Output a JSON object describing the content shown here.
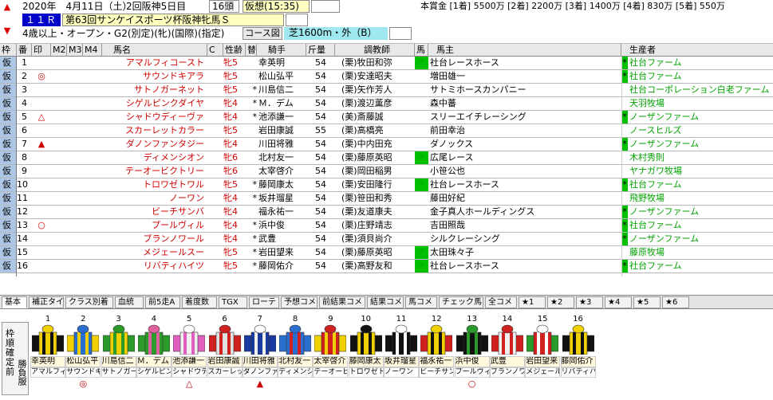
{
  "header": {
    "date": "2020年　4月11日（土）",
    "meeting": "2回阪神5日目",
    "heads": "16頭",
    "forecast": "仮想(15:35)",
    "race_no": "１１Ｒ",
    "race_name": "第63回サンケイスポーツ杯阪神牝馬Ｓ",
    "conditions": "4歳以上・オープン・G2(別定)(牝)(国際)(指定)",
    "course_label": "コース図",
    "course": "芝1600m・外（B）",
    "prize": "本賞金 [1着] 5500万 [2着] 2200万 [3着] 1400万 [4着] 830万 [5着] 550万",
    "up_arrow": "▲",
    "down_arrow": "▼"
  },
  "columns": [
    "枠",
    "番",
    "印",
    "M2",
    "M3",
    "M4",
    "馬名",
    "C",
    "性齢",
    "替",
    "騎手",
    "斤量",
    "調教師",
    "馬",
    "馬主",
    "生産者"
  ],
  "rows": [
    {
      "waku": "仮",
      "num": "1",
      "mark": "",
      "name": "アマルフィコースト",
      "sex": "牝5",
      "change": "",
      "jockey": "幸英明",
      "weight": "54",
      "trainer": "(栗)牧田和弥",
      "flag": "*",
      "owner": "社台レースホース",
      "bflag": "*",
      "breeder": "社台ファーム"
    },
    {
      "waku": "仮",
      "num": "2",
      "mark": "◎",
      "name": "サウンドキアラ",
      "sex": "牝5",
      "change": "",
      "jockey": "松山弘平",
      "weight": "54",
      "trainer": "(栗)安達昭夫",
      "flag": "",
      "owner": "増田雄一",
      "bflag": "*",
      "breeder": "社台ファーム"
    },
    {
      "waku": "仮",
      "num": "3",
      "mark": "",
      "name": "サトノガーネット",
      "sex": "牝5",
      "change": "*",
      "jockey": "川島信二",
      "weight": "54",
      "trainer": "(栗)矢作芳人",
      "flag": "",
      "owner": "サトミホースカンパニー",
      "bflag": "",
      "breeder": "社台コーポレーション白老ファーム"
    },
    {
      "waku": "仮",
      "num": "4",
      "mark": "",
      "name": "シゲルピンクダイヤ",
      "sex": "牝4",
      "change": "*",
      "jockey": "Ｍ．デム",
      "weight": "54",
      "trainer": "(栗)渡辺薫彦",
      "flag": "",
      "owner": "森中蕃",
      "bflag": "",
      "breeder": "天羽牧場"
    },
    {
      "waku": "仮",
      "num": "5",
      "mark": "△",
      "name": "シャドウディーヴァ",
      "sex": "牝4",
      "change": "*",
      "jockey": "池添謙一",
      "weight": "54",
      "trainer": "(美)斎藤誠",
      "flag": "",
      "owner": "スリーエイチレーシング",
      "bflag": "*",
      "breeder": "ノーザンファーム"
    },
    {
      "waku": "仮",
      "num": "6",
      "mark": "",
      "name": "スカーレットカラー",
      "sex": "牝5",
      "change": "",
      "jockey": "岩田康誠",
      "weight": "55",
      "trainer": "(栗)高橋亮",
      "flag": "",
      "owner": "前田幸治",
      "bflag": "",
      "breeder": "ノースヒルズ"
    },
    {
      "waku": "仮",
      "num": "7",
      "mark": "▲",
      "name": "ダノンファンタジー",
      "sex": "牝4",
      "change": "",
      "jockey": "川田将雅",
      "weight": "54",
      "trainer": "(栗)中内田充",
      "flag": "",
      "owner": "ダノックス",
      "bflag": "*",
      "breeder": "ノーザンファーム"
    },
    {
      "waku": "仮",
      "num": "8",
      "mark": "",
      "name": "ディメンシオン",
      "sex": "牝6",
      "change": "",
      "jockey": "北村友一",
      "weight": "54",
      "trainer": "(栗)藤原英昭",
      "flag": "*",
      "owner": "広尾レース",
      "bflag": "",
      "breeder": "木村秀則"
    },
    {
      "waku": "仮",
      "num": "9",
      "mark": "",
      "name": "テーオービクトリー",
      "sex": "牝6",
      "change": "",
      "jockey": "太宰啓介",
      "weight": "54",
      "trainer": "(栗)岡田稲男",
      "flag": "",
      "owner": "小笹公也",
      "bflag": "",
      "breeder": "ヤナガワ牧場"
    },
    {
      "waku": "仮",
      "num": "10",
      "mark": "",
      "name": "トロワゼトワル",
      "sex": "牝5",
      "change": "*",
      "jockey": "藤岡康太",
      "weight": "54",
      "trainer": "(栗)安田隆行",
      "flag": "*",
      "owner": "社台レースホース",
      "bflag": "*",
      "breeder": "社台ファーム"
    },
    {
      "waku": "仮",
      "num": "11",
      "mark": "",
      "name": "ノーワン",
      "sex": "牝4",
      "change": "*",
      "jockey": "坂井瑠星",
      "weight": "54",
      "trainer": "(栗)笹田和秀",
      "flag": "",
      "owner": "藤田好紀",
      "bflag": "",
      "breeder": "飛野牧場"
    },
    {
      "waku": "仮",
      "num": "12",
      "mark": "",
      "name": "ビーチサンバ",
      "sex": "牝4",
      "change": "",
      "jockey": "福永祐一",
      "weight": "54",
      "trainer": "(栗)友道康夫",
      "flag": "",
      "owner": "金子真人ホールディングス",
      "bflag": "*",
      "breeder": "ノーザンファーム"
    },
    {
      "waku": "仮",
      "num": "13",
      "mark": "○",
      "name": "プールヴィル",
      "sex": "牝4",
      "change": "*",
      "jockey": "浜中俊",
      "weight": "54",
      "trainer": "(栗)庄野靖志",
      "flag": "",
      "owner": "吉田照哉",
      "bflag": "*",
      "breeder": "社台ファーム"
    },
    {
      "waku": "仮",
      "num": "14",
      "mark": "",
      "name": "ブランノワール",
      "sex": "牝4",
      "change": "*",
      "jockey": "武豊",
      "weight": "54",
      "trainer": "(栗)須貝尚介",
      "flag": "",
      "owner": "シルクレーシング",
      "bflag": "*",
      "breeder": "ノーザンファーム"
    },
    {
      "waku": "仮",
      "num": "15",
      "mark": "",
      "name": "メジェールスー",
      "sex": "牝5",
      "change": "*",
      "jockey": "岩田望来",
      "weight": "54",
      "trainer": "(栗)藤原英昭",
      "flag": "*",
      "owner": "太田珠々子",
      "bflag": "",
      "breeder": "藤原牧場"
    },
    {
      "waku": "仮",
      "num": "16",
      "mark": "",
      "name": "リバティハイツ",
      "sex": "牝5",
      "change": "*",
      "jockey": "藤岡佑介",
      "weight": "54",
      "trainer": "(栗)高野友和",
      "flag": "*",
      "owner": "社台レースホース",
      "bflag": "*",
      "breeder": "社台ファーム"
    }
  ],
  "tabs": [
    "基本",
    "補正タイム",
    "クラス別着",
    "血統",
    "前5走A",
    "着度数",
    "TGX",
    "ローテ",
    "予想コメ",
    "前結果コメ",
    "結果コメ",
    "馬コメ",
    "チェック馬コメ",
    "全コメ",
    "★1",
    "★2",
    "★3",
    "★4",
    "★5",
    "★6"
  ],
  "side_label": "枠\n順\n確\n定\n前",
  "side_label2": "勝負服",
  "silks": [
    {
      "n": "1",
      "jockey": "幸英明",
      "horse": "アマルフィコ",
      "mark": ""
    },
    {
      "n": "2",
      "jockey": "松山弘平",
      "horse": "サウンドキア",
      "mark": "◎"
    },
    {
      "n": "3",
      "jockey": "川島信二",
      "horse": "サトノガーネ",
      "mark": ""
    },
    {
      "n": "4",
      "jockey": "Ｍ．デム",
      "horse": "シゲルピンク",
      "mark": ""
    },
    {
      "n": "5",
      "jockey": "池添謙一",
      "horse": "シャドウディ",
      "mark": "△"
    },
    {
      "n": "6",
      "jockey": "岩田康誠",
      "horse": "スカーレット",
      "mark": ""
    },
    {
      "n": "7",
      "jockey": "川田将雅",
      "horse": "ダノンファン",
      "mark": "▲"
    },
    {
      "n": "8",
      "jockey": "北村友一",
      "horse": "ディメンシオ",
      "mark": ""
    },
    {
      "n": "9",
      "jockey": "太宰啓介",
      "horse": "テーオービク",
      "mark": ""
    },
    {
      "n": "10",
      "jockey": "藤岡康太",
      "horse": "トロワゼトワ",
      "mark": ""
    },
    {
      "n": "11",
      "jockey": "坂井瑠星",
      "horse": "ノーワン",
      "mark": ""
    },
    {
      "n": "12",
      "jockey": "福永祐一",
      "horse": "ビーチサンバ",
      "mark": ""
    },
    {
      "n": "13",
      "jockey": "浜中俊",
      "horse": "プールヴィル",
      "mark": "○"
    },
    {
      "n": "14",
      "jockey": "武豊",
      "horse": "ブランノワール",
      "mark": ""
    },
    {
      "n": "15",
      "jockey": "岩田望来",
      "horse": "メジェールス",
      "mark": ""
    },
    {
      "n": "16",
      "jockey": "藤岡佑介",
      "horse": "リバティハイ",
      "mark": ""
    }
  ],
  "silk_colors": [
    {
      "body": "#f0d000",
      "stripe": "#111",
      "cap": "#f0d000",
      "sleeve": "#111"
    },
    {
      "body": "#2a6fd0",
      "stripe": "#f0d000",
      "cap": "#2a6fd0",
      "sleeve": "#f0d000"
    },
    {
      "body": "#f0d000",
      "stripe": "#2a9a2a",
      "cap": "#2a9a2a",
      "sleeve": "#2a9a2a"
    },
    {
      "body": "#2a9a2a",
      "stripe": "#e060a0",
      "cap": "#e060a0",
      "sleeve": "#2a9a2a"
    },
    {
      "body": "#f0f0f0",
      "stripe": "#e060c0",
      "cap": "#ffffff",
      "sleeve": "#e060c0"
    },
    {
      "body": "#e0e0e0",
      "stripe": "#d02020",
      "cap": "#d02020",
      "sleeve": "#d02020"
    },
    {
      "body": "#1a3aa0",
      "stripe": "#f0f0f0",
      "cap": "#ffffff",
      "sleeve": "#1a3aa0"
    },
    {
      "body": "#2a6fd0",
      "stripe": "#d02020",
      "cap": "#2a6fd0",
      "sleeve": "#2a6fd0"
    },
    {
      "body": "#d02020",
      "stripe": "#f0d000",
      "cap": "#d02020",
      "sleeve": "#f0d000"
    },
    {
      "body": "#f0d000",
      "stripe": "#111",
      "cap": "#111",
      "sleeve": "#111"
    },
    {
      "body": "#111111",
      "stripe": "#ffffff",
      "cap": "#ffffff",
      "sleeve": "#111"
    },
    {
      "body": "#f0d000",
      "stripe": "#111",
      "cap": "#f0d000",
      "sleeve": "#d02020"
    },
    {
      "body": "#111111",
      "stripe": "#2a9a2a",
      "cap": "#2a9a2a",
      "sleeve": "#111"
    },
    {
      "body": "#f0f0f0",
      "stripe": "#d02020",
      "cap": "#d02020",
      "sleeve": "#d02020"
    },
    {
      "body": "#d02020",
      "stripe": "#ffffff",
      "cap": "#ffffff",
      "sleeve": "#2a9a2a"
    },
    {
      "body": "#f0d000",
      "stripe": "#111",
      "cap": "#f0d000",
      "sleeve": "#111"
    }
  ],
  "colors": {
    "waku_bg": "#aec6e6",
    "name_color": "#d00000",
    "breeder_green": "#00a000",
    "race_no_bg": "#0000c8",
    "course_bg": "#9fe8f0",
    "prog_bg": "#ffffc0"
  }
}
